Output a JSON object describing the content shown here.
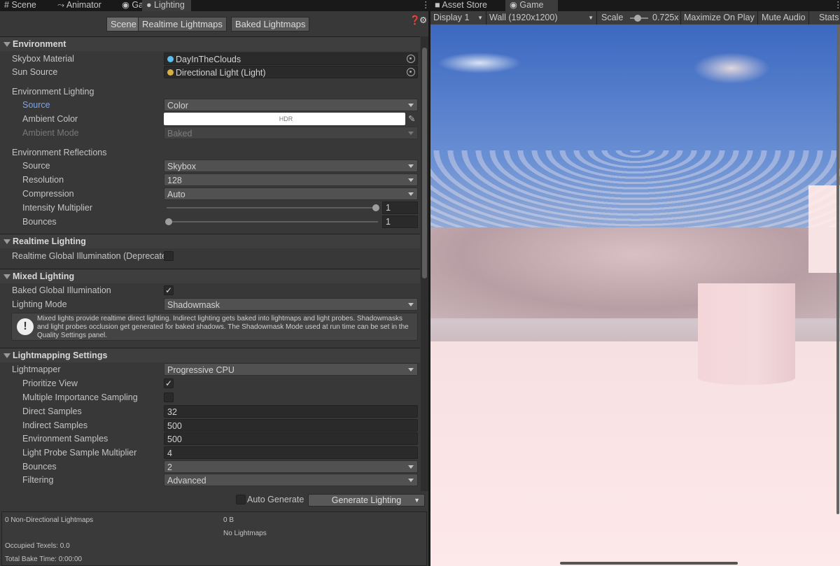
{
  "left_tabs": [
    {
      "label": "Scene",
      "icon": "grid-icon",
      "g": "#"
    },
    {
      "label": "Animator",
      "icon": "animator-icon",
      "g": "⤳"
    },
    {
      "label": "Game",
      "icon": "gamepad-icon",
      "g": "🎮"
    },
    {
      "label": "Lighting",
      "icon": "lightbulb-icon",
      "g": "💡"
    }
  ],
  "right_tabs": [
    {
      "label": "Asset Store",
      "icon": "bag-icon",
      "g": "🛍"
    },
    {
      "label": "Game",
      "icon": "gamepad-icon",
      "g": "🎮"
    }
  ],
  "subtabs": [
    "Scene",
    "Realtime Lightmaps",
    "Baked Lightmaps"
  ],
  "sections": {
    "environment": "Environment",
    "realtime": "Realtime Lighting",
    "mixed": "Mixed Lighting",
    "lightmapping": "Lightmapping Settings"
  },
  "rows": {
    "skybox": {
      "label": "Skybox Material",
      "value": "DayInTheClouds"
    },
    "sun": {
      "label": "Sun Source",
      "value": "Directional Light (Light)"
    },
    "env_lighting": "Environment Lighting",
    "source": {
      "label": "Source",
      "value": "Color"
    },
    "ambient_color": {
      "label": "Ambient Color",
      "value": "HDR"
    },
    "ambient_mode": {
      "label": "Ambient Mode",
      "value": "Baked"
    },
    "env_reflections": "Environment Reflections",
    "refl_source": {
      "label": "Source",
      "value": "Skybox"
    },
    "resolution": {
      "label": "Resolution",
      "value": "128"
    },
    "compression": {
      "label": "Compression",
      "value": "Auto"
    },
    "intensity": {
      "label": "Intensity Multiplier",
      "value": "1",
      "fraction": 1
    },
    "refl_bounces": {
      "label": "Bounces",
      "value": "1",
      "fraction": 0
    },
    "rgi": {
      "label": "Realtime Global Illumination (Deprecate",
      "checked": false
    },
    "bgi": {
      "label": "Baked Global Illumination",
      "checked": true
    },
    "lighting_mode": {
      "label": "Lighting Mode",
      "value": "Shadowmask"
    },
    "help": "Mixed lights provide realtime direct lighting. Indirect lighting gets baked into lightmaps and light probes. Shadowmasks and light probes occlusion get generated for baked shadows. The Shadowmask Mode used at run time can be set in the Quality Settings panel.",
    "lightmapper": {
      "label": "Lightmapper",
      "value": "Progressive CPU"
    },
    "prioritize": {
      "label": "Prioritize View",
      "checked": true
    },
    "mis": {
      "label": "Multiple Importance Sampling",
      "checked": false
    },
    "direct": {
      "label": "Direct Samples",
      "value": "32"
    },
    "indirect": {
      "label": "Indirect Samples",
      "value": "500"
    },
    "envsamples": {
      "label": "Environment Samples",
      "value": "500"
    },
    "lpsm": {
      "label": "Light Probe Sample Multiplier",
      "value": "4"
    },
    "bounces": {
      "label": "Bounces",
      "value": "2"
    },
    "filtering": {
      "label": "Filtering",
      "value": "Advanced"
    }
  },
  "bottom": {
    "auto_generate": "Auto Generate",
    "generate": "Generate Lighting"
  },
  "info": {
    "lightmaps": "0 Non-Directional Lightmaps",
    "size": "0 B",
    "none": "No Lightmaps",
    "texels": "Occupied Texels: 0.0",
    "bake_time": "Total Bake Time: 0:00:00"
  },
  "game_toolbar": {
    "display": "Display 1",
    "resolution": "Wall (1920x1200)",
    "scale_label": "Scale",
    "scale_value": "0.725x",
    "maximize": "Maximize On Play",
    "mute": "Mute Audio",
    "stats": "Stats"
  },
  "colors": {
    "accent_label": "#7aa6f0",
    "panel": "#383838",
    "header": "#3e3e3e"
  }
}
